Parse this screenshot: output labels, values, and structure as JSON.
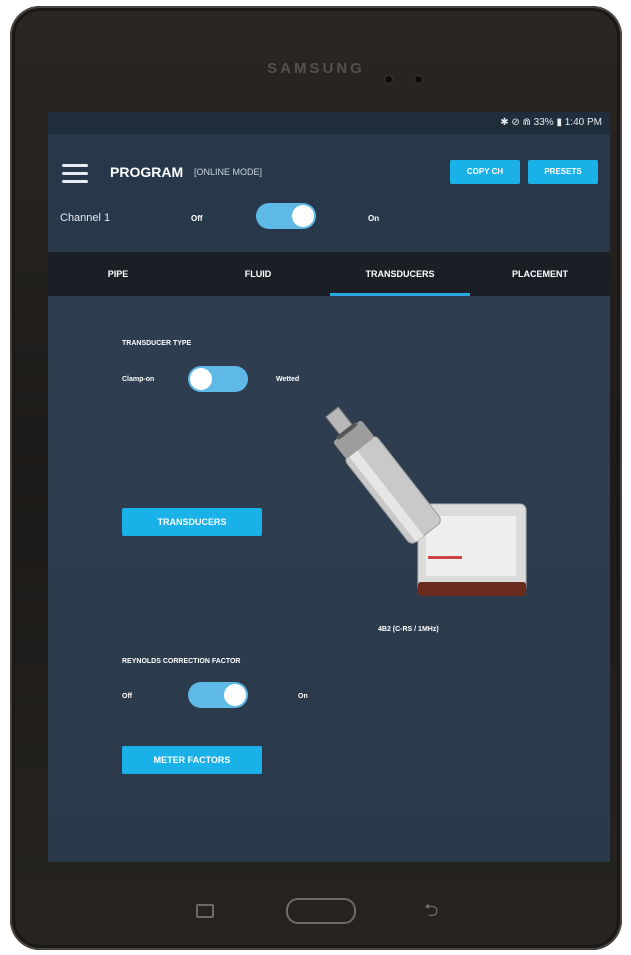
{
  "device": {
    "brand": "SAMSUNG"
  },
  "status": {
    "text": "✱ ⊘ ⋒ 33% ▮ 1:40 PM"
  },
  "appbar": {
    "title": "PROGRAM",
    "subtitle": "[ONLINE MODE]",
    "copy_button": "COPY CH",
    "presets_button": "PRESETS",
    "channel_label": "Channel 1",
    "off_label": "Off",
    "on_label": "On",
    "channel_enabled": true
  },
  "tabs": [
    {
      "label": "PIPE",
      "active": false
    },
    {
      "label": "FLUID",
      "active": false
    },
    {
      "label": "TRANSDUCERS",
      "active": true
    },
    {
      "label": "PLACEMENT",
      "active": false
    }
  ],
  "transducer": {
    "section_title": "TRANSDUCER TYPE",
    "left_label": "Clamp-on",
    "right_label": "Wetted",
    "selected": "Clamp-on",
    "button": "TRANSDUCERS",
    "image_caption": "4B2 (C-RS / 1MHz)"
  },
  "reynolds": {
    "section_title": "REYNOLDS CORRECTION FACTOR",
    "off_label": "Off",
    "on_label": "On",
    "enabled": true,
    "button": "METER FACTORS"
  },
  "icons": {
    "menu": "hamburger-menu-icon",
    "recent": "recent-apps-icon",
    "home": "home-button-icon",
    "back": "back-icon"
  },
  "colors": {
    "accent": "#1ab0e8",
    "toggle_track": "#5fb9e6",
    "background": "#2b3b4c"
  }
}
